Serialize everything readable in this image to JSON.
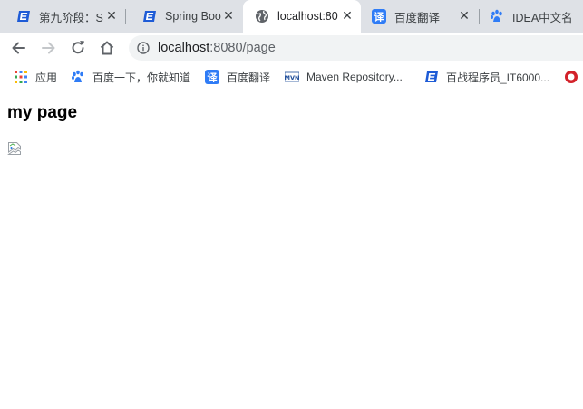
{
  "browser": {
    "tabs": [
      {
        "title": "第九阶段：S",
        "favicon": "sxt-logo-icon",
        "active": false
      },
      {
        "title": "Spring Boo",
        "favicon": "sxt-logo-icon",
        "active": false
      },
      {
        "title": "localhost:80",
        "favicon": "globe-icon",
        "active": true
      },
      {
        "title": "百度翻译",
        "favicon": "baidu-translate-icon",
        "active": false
      },
      {
        "title": "IDEA中文名",
        "favicon": "baidu-paw-icon",
        "active": false
      }
    ],
    "address": {
      "host": "localhost",
      "path": ":8080/page"
    },
    "bookmarks": [
      {
        "label": "应用",
        "icon": "apps-grid-icon"
      },
      {
        "label": "百度一下，你就知道",
        "icon": "baidu-paw-icon"
      },
      {
        "label": "百度翻译",
        "icon": "baidu-translate-icon"
      },
      {
        "label": "Maven Repository...",
        "icon": "maven-icon"
      },
      {
        "label": "百战程序员_IT6000...",
        "icon": "sxt-logo-icon"
      }
    ]
  },
  "page": {
    "heading": "my page"
  },
  "colors": {
    "tabstrip_bg": "#dee1e6",
    "omnibox_bg": "#f1f3f4",
    "accent_blue": "#1a73e8",
    "sxt_blue": "#1e5bd6"
  }
}
